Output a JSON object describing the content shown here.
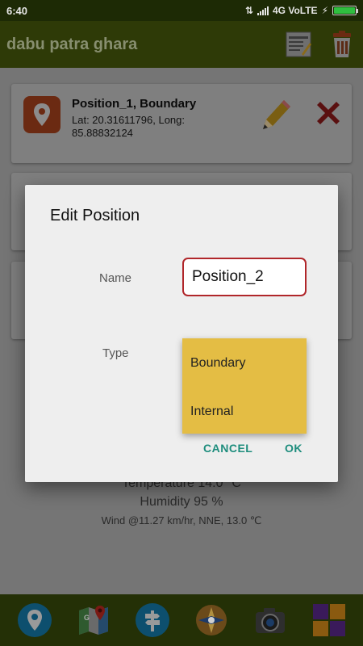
{
  "status_bar": {
    "time": "6:40",
    "network": "4G VoLTE",
    "battery_level": 1.0
  },
  "app_bar": {
    "title": "dabu patra ghara",
    "actions": [
      "notes-icon",
      "delete-all-icon"
    ]
  },
  "cards": [
    {
      "title": "Position_1, Boundary",
      "subtitle": "Lat: 20.31611796, Long: 85.88832124"
    }
  ],
  "weather": {
    "temperature": "Temperature 14.0 °C",
    "humidity": "Humidity 95 %",
    "wind": "Wind @11.27 km/hr, NNE, 13.0 ℃"
  },
  "dialog": {
    "title": "Edit Position",
    "name_label": "Name",
    "name_value": "Position_2",
    "type_label": "Type",
    "type_options": [
      "Boundary",
      "Internal"
    ],
    "cancel_label": "CANCEL",
    "ok_label": "OK"
  },
  "bottom_bar": {
    "icons": [
      "location-pin-icon",
      "google-maps-icon",
      "signpost-icon",
      "compass-icon",
      "camera-icon",
      "grid-icon"
    ]
  },
  "colors": {
    "app_bar": "#2e3a07",
    "dialog_accent": "#1e8d7d",
    "input_border": "#b0262a",
    "menu_bg": "#e4bd44"
  }
}
